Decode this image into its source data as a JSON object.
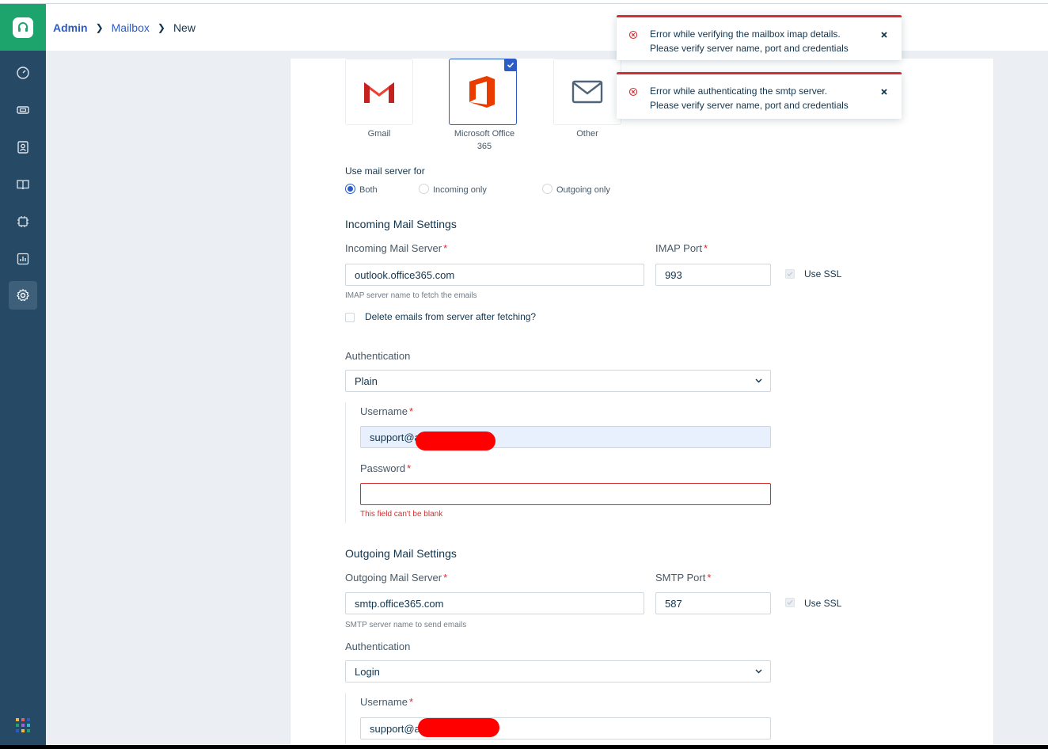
{
  "breadcrumb": {
    "admin": "Admin",
    "mailbox": "Mailbox",
    "current": "New"
  },
  "providers": [
    {
      "label": "Gmail",
      "selected": false,
      "icon": "gmail-icon"
    },
    {
      "label_line1": "Microsoft Office",
      "label_line2": "365",
      "selected": true,
      "icon": "office365-icon"
    },
    {
      "label": "Other",
      "selected": false,
      "icon": "envelope-icon"
    }
  ],
  "mail_server_usage": {
    "label": "Use mail server for",
    "options": [
      "Both",
      "Incoming only",
      "Outgoing only"
    ],
    "selected": "Both"
  },
  "incoming": {
    "title": "Incoming Mail Settings",
    "server_label": "Incoming Mail Server",
    "server_value": "outlook.office365.com",
    "server_hint": "IMAP server name to fetch the emails",
    "port_label": "IMAP Port",
    "port_value": "993",
    "ssl_label": "Use SSL",
    "delete_label": "Delete emails from server after fetching?",
    "auth_label": "Authentication",
    "auth_value": "Plain",
    "username_label": "Username",
    "username_value": "support@a",
    "password_label": "Password",
    "password_error": "This field can't be blank"
  },
  "outgoing": {
    "title": "Outgoing Mail Settings",
    "server_label": "Outgoing Mail Server",
    "server_value": "smtp.office365.com",
    "server_hint": "SMTP server name to send emails",
    "port_label": "SMTP Port",
    "port_value": "587",
    "ssl_label": "Use SSL",
    "auth_label": "Authentication",
    "auth_value": "Login",
    "username_label": "Username",
    "username_value": "support@a"
  },
  "toasts": [
    {
      "line1": "Error while verifying the mailbox imap details.",
      "line2": "Please verify server name, port and credentials"
    },
    {
      "line1": "Error while authenticating the smtp server.",
      "line2": "Please verify server name, port and credentials"
    }
  ],
  "colors": {
    "accent": "#2c5cc5",
    "sidebar": "#264966",
    "brand": "#1da36c",
    "error": "#d72d30"
  }
}
